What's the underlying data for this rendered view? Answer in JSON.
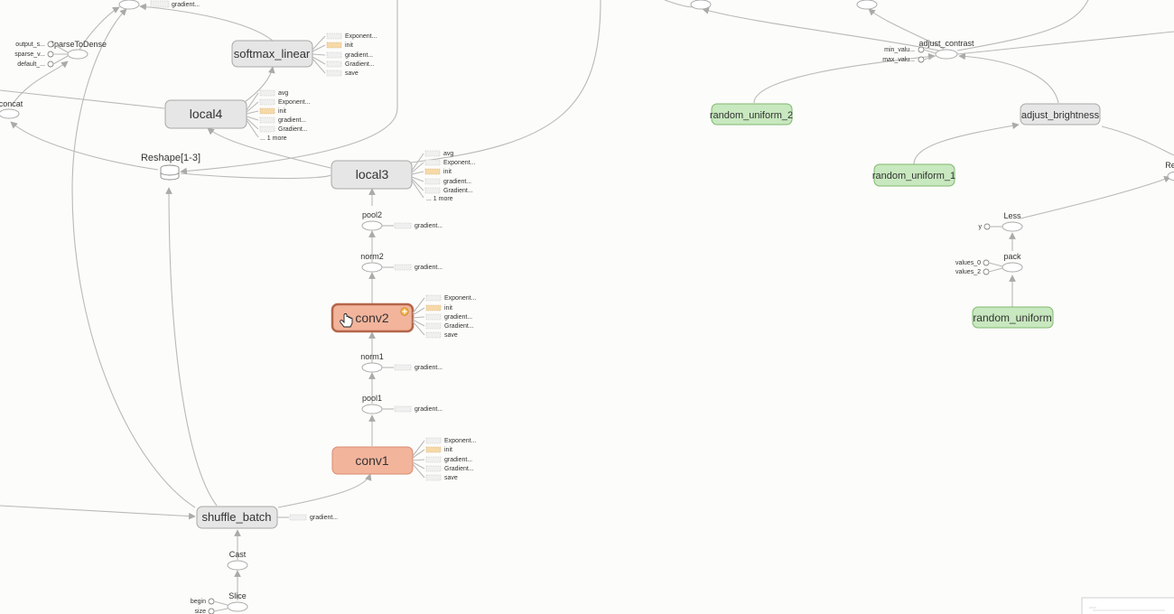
{
  "namespaces": {
    "softmax_linear": "softmax_linear",
    "local4": "local4",
    "local3": "local3",
    "conv2": "conv2",
    "conv1": "conv1",
    "shuffle_batch": "shuffle_batch",
    "random_uniform_2": "random_uniform_2",
    "random_uniform_1": "random_uniform_1",
    "random_uniform": "random_uniform",
    "adjust_brightness": "adjust_brightness"
  },
  "ops": {
    "sparse_to_dense": "SparseToDense",
    "concat": "concat",
    "reshape": "Reshape[1-3]",
    "pool2": "pool2",
    "norm2": "norm2",
    "norm1": "norm1",
    "pool1": "pool1",
    "cast": "Cast",
    "slice": "Slice",
    "adjust_contrast": "adjust_contrast",
    "less": "Less",
    "pack": "pack",
    "re_truncated": "Re"
  },
  "aux_labels": {
    "top_gradient": "gradient...",
    "sparse_inputs": [
      "output_s...",
      "sparse_v...",
      "default_..."
    ],
    "softmax_aux": [
      "Exponent...",
      "init",
      "gradient...",
      "Gradient...",
      "save"
    ],
    "local4_aux": [
      "avg",
      "Exponent...",
      "init",
      "gradient...",
      "Gradient...",
      "... 1 more"
    ],
    "local3_aux": [
      "avg",
      "Exponent...",
      "init",
      "gradient...",
      "Gradient...",
      "... 1 more"
    ],
    "pool2_aux": "gradient...",
    "norm2_aux": "gradient...",
    "conv2_aux": [
      "Exponent...",
      "init",
      "gradient...",
      "Gradient...",
      "save"
    ],
    "norm1_aux": "gradient...",
    "pool1_aux": "gradient...",
    "conv1_aux": [
      "Exponent...",
      "init",
      "gradient...",
      "Gradient...",
      "save"
    ],
    "shuffle_aux": "gradient...",
    "slice_inputs": [
      "begin",
      "size"
    ],
    "contrast_inputs": [
      "min_valu...",
      "max_valu..."
    ],
    "less_input": "y",
    "pack_inputs": [
      "values_0",
      "values_2"
    ]
  },
  "icons": {
    "cursor": "hand-pointer-icon",
    "expand": "plus-circle-icon",
    "reshape": "database-icon"
  },
  "colors": {
    "conv_fill": "#f3b49c",
    "random_fill": "#c8e8bf",
    "namespace_fill": "#e6e6e6",
    "init_chip": "#f6d9a8"
  }
}
